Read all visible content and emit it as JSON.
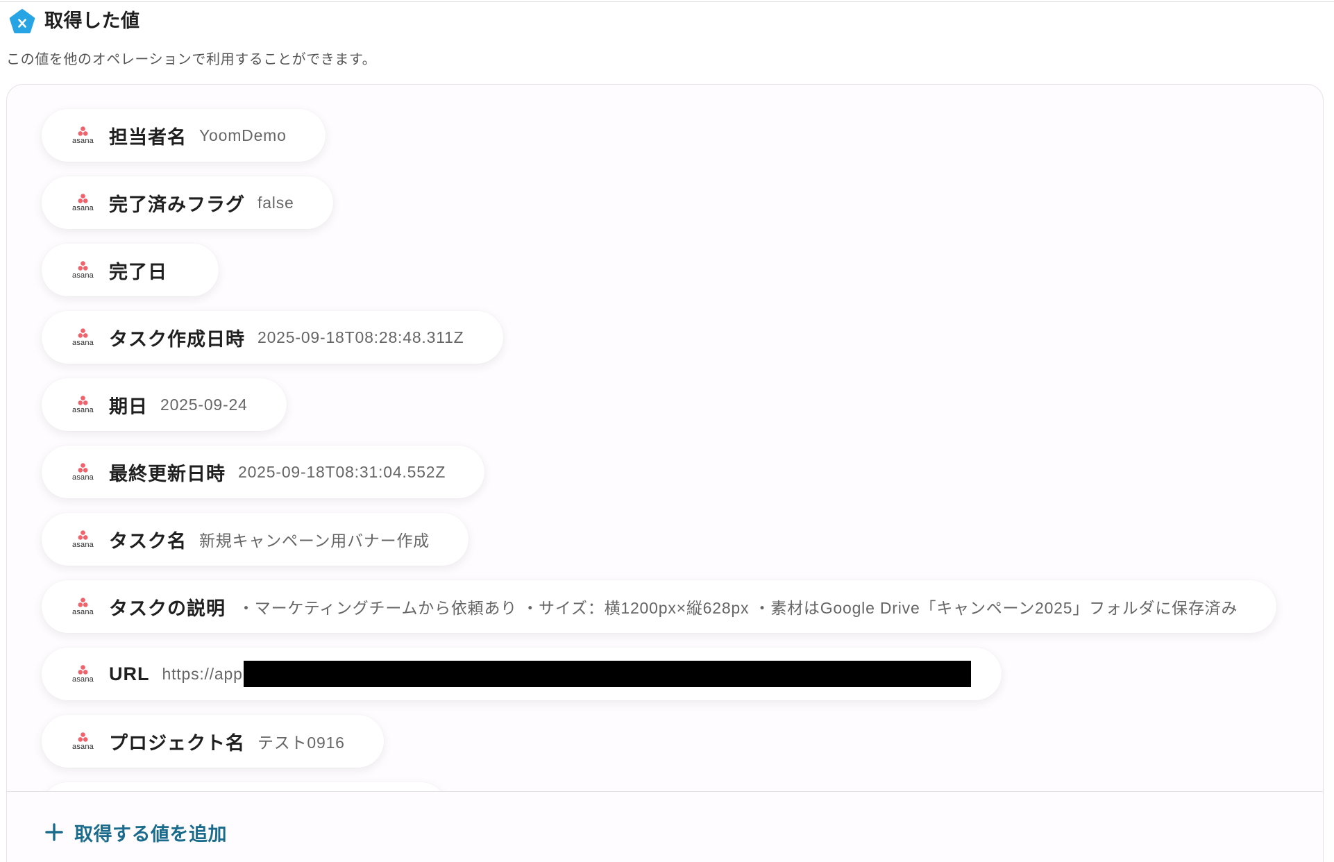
{
  "header": {
    "icon": "variable-icon",
    "title": "取得した値",
    "description": "この値を他のオペレーションで利用することができます。"
  },
  "app": {
    "icon": "asana-logo-icon",
    "logo_text": "asana"
  },
  "fields": [
    {
      "label": "担当者名",
      "value": "YoomDemo"
    },
    {
      "label": "完了済みフラグ",
      "value": "false"
    },
    {
      "label": "完了日",
      "value": ""
    },
    {
      "label": "タスク作成日時",
      "value": "2025-09-18T08:28:48.311Z"
    },
    {
      "label": "期日",
      "value": "2025-09-24"
    },
    {
      "label": "最終更新日時",
      "value": "2025-09-18T08:31:04.552Z"
    },
    {
      "label": "タスク名",
      "value": "新規キャンペーン用バナー作成"
    },
    {
      "label": "タスクの説明",
      "value": "・マーケティングチームから依頼あり ・サイズ：横1200px×縦628px ・素材はGoogle Drive「キャンペーン2025」フォルダに保存済み"
    },
    {
      "label": "URL",
      "value": "https://app"
    },
    {
      "label": "プロジェクト名",
      "value": "テスト0916"
    }
  ],
  "footer": {
    "icon": "plus-icon",
    "add_label": "取得する値を追加"
  },
  "colors": {
    "accent": "#27a4e3",
    "asana": "#f0636d",
    "action": "#1b6b8c",
    "label_text": "#1f1f1f",
    "value_text": "#666666"
  }
}
